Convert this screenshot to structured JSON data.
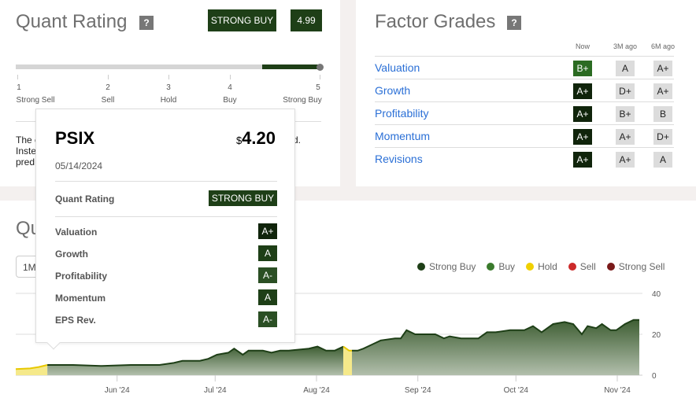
{
  "quant_rating": {
    "title": "Quant Rating",
    "help": "?",
    "rating": "STRONG BUY",
    "score": "4.99",
    "score_value": 4.99,
    "scale": [
      {
        "num": "1",
        "label": "Strong Sell"
      },
      {
        "num": "2",
        "label": "Sell"
      },
      {
        "num": "3",
        "label": "Hold"
      },
      {
        "num": "4",
        "label": "Buy"
      },
      {
        "num": "5",
        "label": "Strong Buy"
      }
    ],
    "desc_fragments": [
      "The c",
      "Inste",
      "pred",
      "d."
    ]
  },
  "factor_grades": {
    "title": "Factor Grades",
    "help": "?",
    "columns": [
      "Now",
      "3M ago",
      "6M ago"
    ],
    "rows": [
      {
        "label": "Valuation",
        "now": "B+",
        "m3": "A",
        "m6": "A+"
      },
      {
        "label": "Growth",
        "now": "A+",
        "m3": "D+",
        "m6": "A+"
      },
      {
        "label": "Profitability",
        "now": "A+",
        "m3": "B+",
        "m6": "B"
      },
      {
        "label": "Momentum",
        "now": "A+",
        "m3": "A+",
        "m6": "D+"
      },
      {
        "label": "Revisions",
        "now": "A+",
        "m3": "A+",
        "m6": "A"
      }
    ]
  },
  "history": {
    "title_fragment": "Qu",
    "range_button": "1M",
    "legend": [
      {
        "label": "Strong Buy",
        "color": "#1e3f17"
      },
      {
        "label": "Buy",
        "color": "#3a7a2c"
      },
      {
        "label": "Hold",
        "color": "#f0d000"
      },
      {
        "label": "Sell",
        "color": "#cc2a2a"
      },
      {
        "label": "Strong Sell",
        "color": "#7a1a1a"
      }
    ]
  },
  "tooltip": {
    "ticker": "PSIX",
    "currency": "$",
    "price": "4.20",
    "date": "05/14/2024",
    "quant_label": "Quant Rating",
    "quant_value": "STRONG BUY",
    "grades": [
      {
        "label": "Valuation",
        "grade": "A+"
      },
      {
        "label": "Growth",
        "grade": "A"
      },
      {
        "label": "Profitability",
        "grade": "A-"
      },
      {
        "label": "Momentum",
        "grade": "A"
      },
      {
        "label": "EPS Rev.",
        "grade": "A-"
      }
    ]
  },
  "chart_data": {
    "type": "area",
    "ylim": [
      0,
      40
    ],
    "yticks": [
      "0",
      "20",
      "40"
    ],
    "xticks": [
      {
        "label": "Jun '24",
        "day": 31
      },
      {
        "label": "Jul '24",
        "day": 61
      },
      {
        "label": "Aug '24",
        "day": 92
      },
      {
        "label": "Sep '24",
        "day": 123
      },
      {
        "label": "Oct '24",
        "day": 153
      },
      {
        "label": "Nov '24",
        "day": 184
      }
    ],
    "x_start_day": 0,
    "x_end_day": 193,
    "points": [
      [
        0,
        3
      ],
      [
        5,
        3.3
      ],
      [
        8,
        4
      ],
      [
        11,
        5
      ],
      [
        20,
        5
      ],
      [
        30,
        4.5
      ],
      [
        40,
        5
      ],
      [
        50,
        5
      ],
      [
        55,
        6
      ],
      [
        58,
        7
      ],
      [
        64,
        7
      ],
      [
        67,
        8
      ],
      [
        70,
        10
      ],
      [
        74,
        11
      ],
      [
        76,
        13
      ],
      [
        79,
        10
      ],
      [
        81,
        12
      ],
      [
        86,
        12
      ],
      [
        89,
        11
      ],
      [
        92,
        12
      ],
      [
        95,
        12
      ],
      [
        102,
        13
      ],
      [
        105,
        14
      ],
      [
        108,
        12
      ],
      [
        111,
        12
      ],
      [
        114,
        14
      ],
      [
        116,
        12
      ],
      [
        119,
        12
      ],
      [
        121,
        13
      ],
      [
        124,
        15
      ],
      [
        127,
        17
      ],
      [
        132,
        18
      ],
      [
        134,
        18
      ],
      [
        136,
        22
      ],
      [
        139,
        20
      ],
      [
        146,
        20
      ],
      [
        149,
        18
      ],
      [
        151,
        19
      ],
      [
        155,
        18
      ],
      [
        161,
        18
      ],
      [
        164,
        21
      ],
      [
        167,
        21
      ],
      [
        172,
        22
      ],
      [
        177,
        22
      ],
      [
        180,
        24
      ],
      [
        183,
        21
      ],
      [
        187,
        25
      ],
      [
        191,
        26
      ],
      [
        194,
        25
      ],
      [
        197,
        20
      ],
      [
        199,
        24
      ],
      [
        202,
        23
      ],
      [
        204,
        25
      ],
      [
        207,
        22
      ],
      [
        209,
        22
      ],
      [
        212,
        25
      ],
      [
        215,
        27
      ],
      [
        217,
        27
      ]
    ],
    "rating_segments": [
      {
        "from": 0,
        "to": 11,
        "rating": "Hold"
      },
      {
        "from": 11,
        "to": 114,
        "rating": "Strong Buy"
      },
      {
        "from": 114,
        "to": 117,
        "rating": "Hold"
      },
      {
        "from": 117,
        "to": 217,
        "rating": "Strong Buy"
      }
    ]
  }
}
